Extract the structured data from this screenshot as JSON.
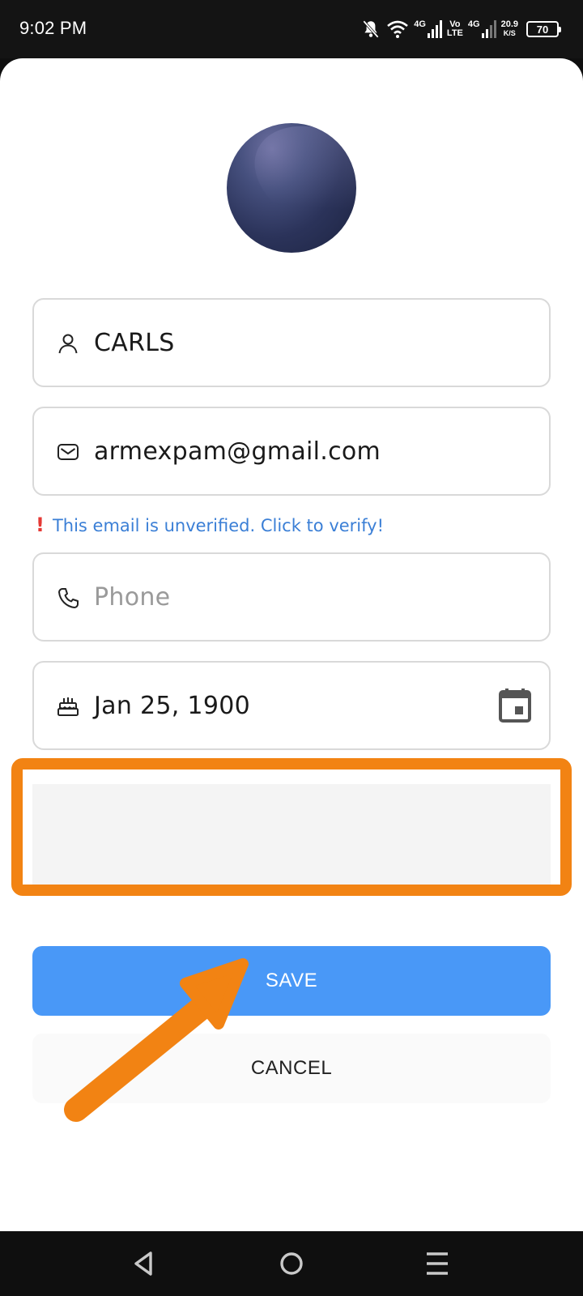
{
  "status_bar": {
    "time": "9:02 PM",
    "net_4g_1": "4G",
    "volte_top": "Vo",
    "volte_bottom": "LTE",
    "net_4g_2": "4G",
    "speed_value": "20.9",
    "speed_unit": "K/S",
    "battery": "70"
  },
  "profile": {
    "name_value": "CARLS",
    "email_value": "armexpam@gmail.com",
    "email_notice": "This email is unverified. Click to verify!",
    "phone_placeholder": "Phone",
    "birthday_value": "Jan 25, 1900"
  },
  "actions": {
    "save_label": "SAVE",
    "cancel_label": "CANCEL"
  },
  "icons": {
    "name": "person-icon",
    "email": "mail-icon",
    "phone": "phone-icon",
    "birthday": "cake-icon",
    "date_picker": "calendar-icon",
    "nav_back": "back-triangle-icon",
    "nav_home": "home-circle-icon",
    "nav_menu": "menu-lines-icon"
  },
  "colors": {
    "primary": "#4998f7",
    "link": "#3b7fd6",
    "error": "#e53935",
    "annotation": "#f28313"
  }
}
